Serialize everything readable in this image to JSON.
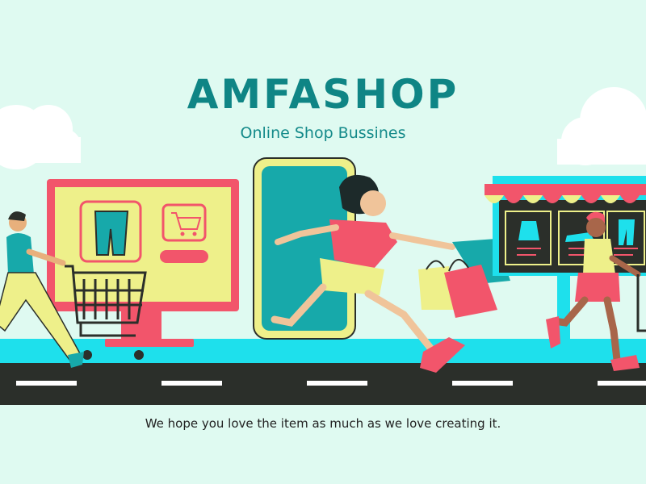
{
  "brand": {
    "title": "AMFASHOP",
    "subtitle": "Online Shop Bussines"
  },
  "footer": {
    "tagline": "We hope you love the item as much as we love creating it."
  },
  "colors": {
    "background": "#dffaf1",
    "title": "#0f8585",
    "subtitle": "#148a8a",
    "road": "#2b2f2a",
    "sidewalk": "#1ee0ec",
    "monitor": "#f2556b",
    "screen": "#eef08a",
    "phone": "#17a9aa",
    "shirt": "#f2556b",
    "pants": "#eef08a",
    "bag_teal": "#17a9aa",
    "bag_pink": "#f2556b",
    "bag_yellow": "#eef08a",
    "store_frame": "#1ee0ec",
    "store_board": "#2b2f2a"
  },
  "icons": {
    "product_pants": "pants-icon",
    "product_cart": "cart-icon",
    "shopping_bag": "shopping-bag-icon"
  }
}
